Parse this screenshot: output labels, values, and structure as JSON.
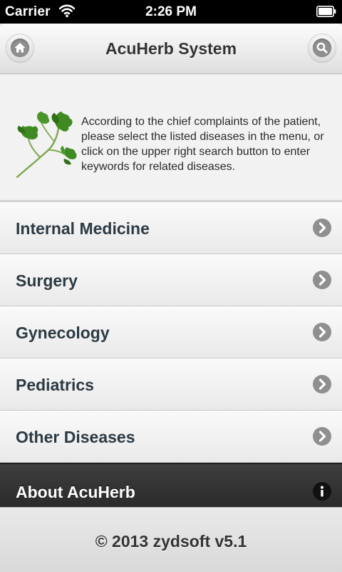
{
  "status_bar": {
    "carrier": "Carrier",
    "time": "2:26 PM"
  },
  "header": {
    "title": "AcuHerb System",
    "left_icon": "home-icon",
    "right_icon": "search-icon"
  },
  "intro": {
    "icon": "herb-leaf-icon",
    "text": "According to the chief complaints of the patient, please select  the listed diseases in the menu, or click on the upper right  search button to enter keywords for related diseases."
  },
  "menu": {
    "items": [
      {
        "label": "Internal Medicine",
        "icon": "chevron-right-icon"
      },
      {
        "label": "Surgery",
        "icon": "chevron-right-icon"
      },
      {
        "label": "Gynecology",
        "icon": "chevron-right-icon"
      },
      {
        "label": "Pediatrics",
        "icon": "chevron-right-icon"
      },
      {
        "label": "Other Diseases",
        "icon": "chevron-right-icon"
      }
    ],
    "about": {
      "label": "About AcuHerb",
      "icon": "info-icon"
    }
  },
  "footer": {
    "text": "© 2013 zydsoft v5.1"
  },
  "colors": {
    "menu_text": "#2c3a44",
    "icon_gray": "#8f8f8f",
    "about_bar": "#333333",
    "leaf_green": "#3a7d1e"
  }
}
